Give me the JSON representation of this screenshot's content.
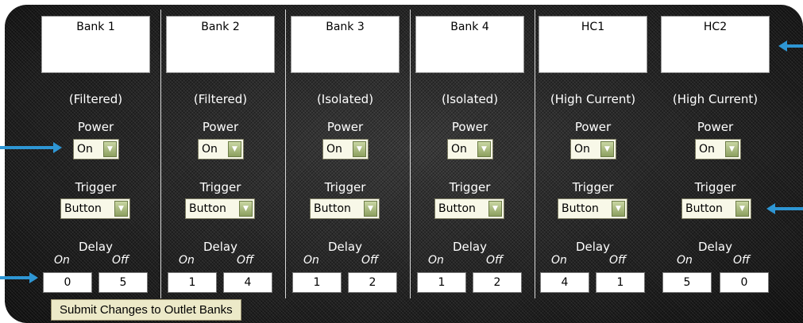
{
  "banks": [
    {
      "name": "Bank 1",
      "type": "(Filtered)",
      "power": "On",
      "trigger": "Button",
      "delay_on": "0",
      "delay_off": "5"
    },
    {
      "name": "Bank 2",
      "type": "(Filtered)",
      "power": "On",
      "trigger": "Button",
      "delay_on": "1",
      "delay_off": "4"
    },
    {
      "name": "Bank 3",
      "type": "(Isolated)",
      "power": "On",
      "trigger": "Button",
      "delay_on": "1",
      "delay_off": "2"
    },
    {
      "name": "Bank 4",
      "type": "(Isolated)",
      "power": "On",
      "trigger": "Button",
      "delay_on": "1",
      "delay_off": "2"
    },
    {
      "name": "HC1",
      "type": "(High Current)",
      "power": "On",
      "trigger": "Button",
      "delay_on": "4",
      "delay_off": "1"
    },
    {
      "name": "HC2",
      "type": "(High Current)",
      "power": "On",
      "trigger": "Button",
      "delay_on": "5",
      "delay_off": "0"
    }
  ],
  "labels": {
    "power": "Power",
    "trigger": "Trigger",
    "delay": "Delay",
    "on": "On",
    "off": "Off"
  },
  "submit_label": "Submit Changes to Outlet Banks",
  "colors": {
    "arrow": "#2e96d4",
    "panel": "#1c1c1c",
    "button": "#ece9c8"
  }
}
